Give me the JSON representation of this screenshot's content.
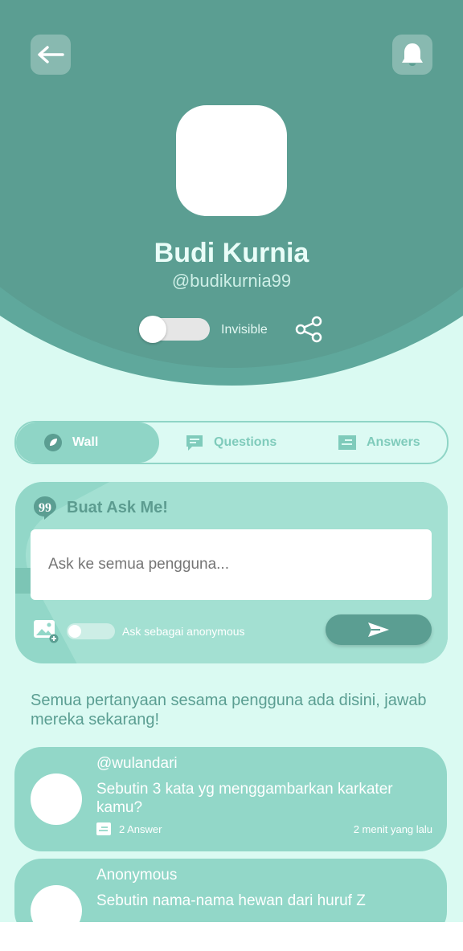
{
  "profile": {
    "name": "Budi Kurnia",
    "handle": "@budikurnia99",
    "visibility_label": "Invisible"
  },
  "tabs": [
    {
      "label": "Wall",
      "icon": "leaf-icon",
      "active": true
    },
    {
      "label": "Questions",
      "icon": "chat-icon",
      "active": false
    },
    {
      "label": "Answers",
      "icon": "answer-icon",
      "active": false
    }
  ],
  "ask": {
    "title": "Buat Ask Me!",
    "placeholder": "Ask ke semua pengguna...",
    "anonymous_label": "Ask sebagai anonymous"
  },
  "feed": {
    "intro": "Semua pertanyaan sesama pengguna ada disini, jawab mereka sekarang!",
    "posts": [
      {
        "user": "@wulandari",
        "question": "Sebutin 3 kata yg menggambarkan karkater kamu?",
        "answers": "2 Answer",
        "time": "2 menit yang lalu"
      },
      {
        "user": "Anonymous",
        "question": "Sebutin nama-nama hewan dari huruf Z"
      }
    ]
  },
  "colors": {
    "header": "#5b9e92",
    "accent": "#92d7c8",
    "background": "#dafaf2"
  }
}
